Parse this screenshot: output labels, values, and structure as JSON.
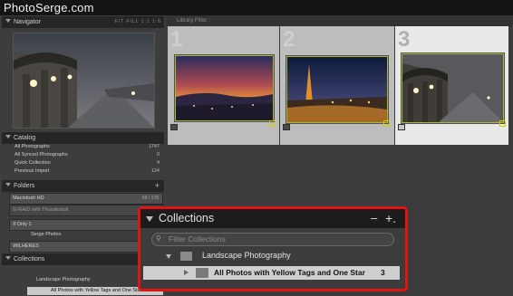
{
  "brand": "PhotoSerge.com",
  "navigator": {
    "title": "Navigator",
    "zoom_options": "FIT  FILL  1:1  1:6"
  },
  "catalog": {
    "title": "Catalog",
    "items": [
      {
        "label": "All Photographs",
        "count": "1747"
      },
      {
        "label": "All Synced Photographs",
        "count": "0"
      },
      {
        "label": "Quick Collection",
        "count": "4"
      },
      {
        "label": "Previous Import",
        "count": "124"
      }
    ]
  },
  "folders": {
    "title": "Folders",
    "add": "+",
    "volumes": [
      {
        "label": "Macintosh HD",
        "count": "69 / 178"
      },
      {
        "label": "G-RAID with Thunderbolt",
        "count": ""
      },
      {
        "label": "If Only 1",
        "count": ""
      },
      {
        "label": "WILHERES",
        "count": ""
      }
    ],
    "subfolder": "Serge Photos"
  },
  "collections_panel": {
    "title": "Collections",
    "set_label": "Landscape Photography",
    "collection_label": "All Photos with Yellow Tags and One Star",
    "collection_count": "3"
  },
  "grid": {
    "filter_label": "Library Filter :",
    "cells": [
      {
        "number": "1"
      },
      {
        "number": "2"
      },
      {
        "number": "3"
      }
    ]
  },
  "popup": {
    "title": "Collections",
    "minus": "–",
    "plus": "+.",
    "search_placeholder": "Filter Collections",
    "set_label": "Landscape Photography",
    "collection_label": "All Photos with Yellow Tags and One Star",
    "collection_count": "3"
  },
  "colors": {
    "highlight_border": "#e01414",
    "tag_yellow": "#d0d000",
    "thumb_border": "#a8b83a"
  }
}
